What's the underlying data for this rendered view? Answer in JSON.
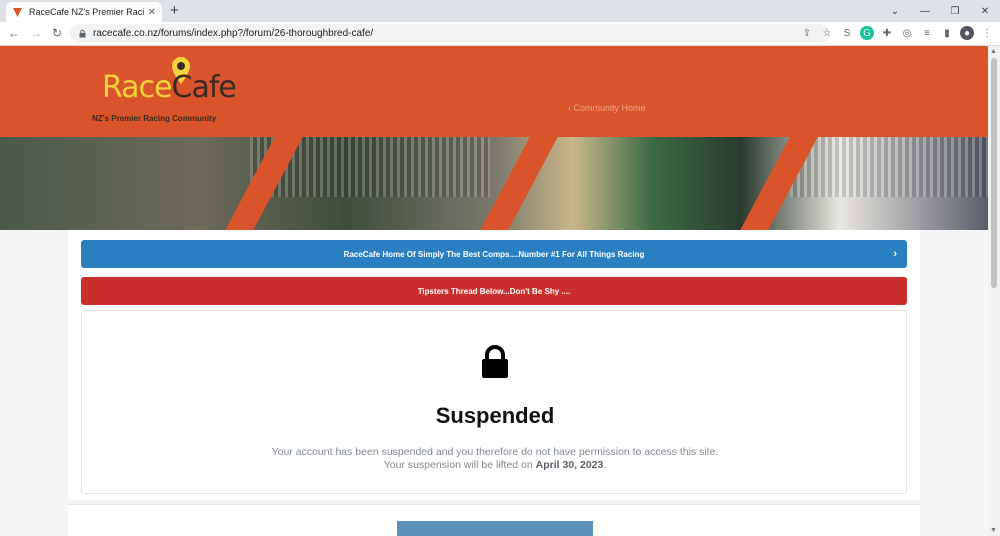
{
  "browser": {
    "tab_title": "RaceCafe NZ's Premier Racing Co",
    "url": "racecafe.co.nz/forums/index.php?/forum/26-thoroughbred-cafe/"
  },
  "header": {
    "logo_race": "Race",
    "logo_cafe": "Cafe",
    "logo_tagline": "NZ's Premier Racing Community",
    "community_link": "‹ Community Home",
    "bg_color": "#d9542b"
  },
  "notices": {
    "blue_text": "RaceCafe Home Of Simply The Best Comps....Number #1 For All Things Racing",
    "red_text": "Tipsters Thread Below...Don't Be Shy ...."
  },
  "suspension": {
    "title": "Suspended",
    "line1": "Your account has been suspended and you therefore do not have permission to access this site.",
    "line2_prefix": "Your suspension will be lifted on",
    "date": "April 30, 2023",
    "line2_suffix": "."
  }
}
